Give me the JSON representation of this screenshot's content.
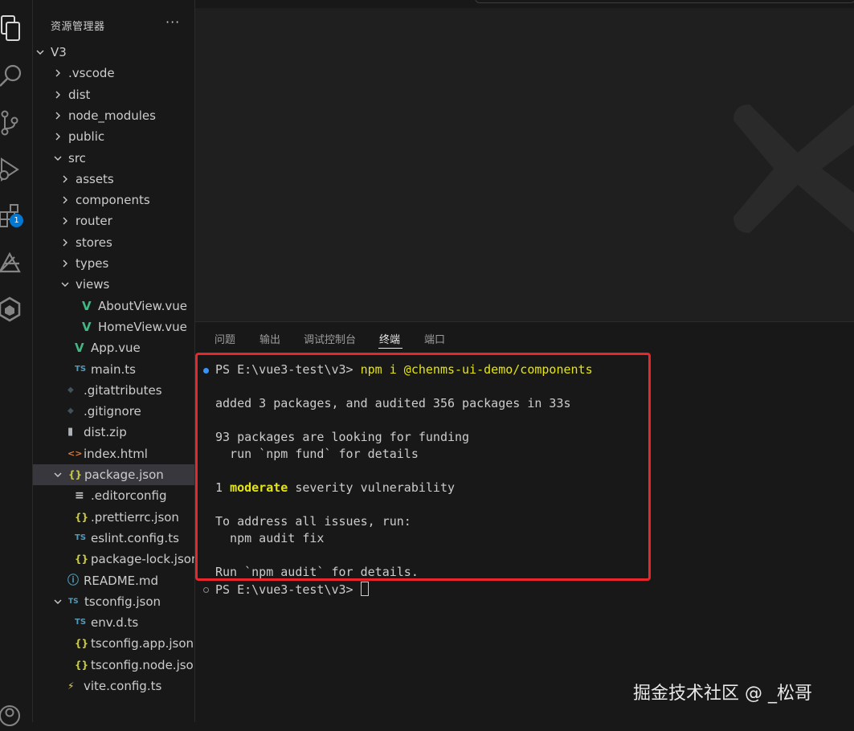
{
  "sidebar": {
    "title": "资源管理器",
    "more": "···",
    "tree": [
      {
        "name": "V3",
        "type": "folder-open",
        "depth": 0,
        "icon": ""
      },
      {
        "name": ".vscode",
        "type": "folder",
        "depth": 1,
        "icon": ""
      },
      {
        "name": "dist",
        "type": "folder",
        "depth": 1,
        "icon": ""
      },
      {
        "name": "node_modules",
        "type": "folder",
        "depth": 1,
        "icon": ""
      },
      {
        "name": "public",
        "type": "folder",
        "depth": 1,
        "icon": ""
      },
      {
        "name": "src",
        "type": "folder-open",
        "depth": 1,
        "icon": ""
      },
      {
        "name": "assets",
        "type": "folder",
        "depth": 2,
        "icon": ""
      },
      {
        "name": "components",
        "type": "folder",
        "depth": 2,
        "icon": ""
      },
      {
        "name": "router",
        "type": "folder",
        "depth": 2,
        "icon": ""
      },
      {
        "name": "stores",
        "type": "folder",
        "depth": 2,
        "icon": ""
      },
      {
        "name": "types",
        "type": "folder",
        "depth": 2,
        "icon": ""
      },
      {
        "name": "views",
        "type": "folder-open",
        "depth": 2,
        "icon": ""
      },
      {
        "name": "AboutView.vue",
        "type": "file",
        "depth": 3,
        "icon": "vue"
      },
      {
        "name": "HomeView.vue",
        "type": "file",
        "depth": 3,
        "icon": "vue"
      },
      {
        "name": "App.vue",
        "type": "file",
        "depth": 2,
        "icon": "vue"
      },
      {
        "name": "main.ts",
        "type": "file",
        "depth": 2,
        "icon": "ts"
      },
      {
        "name": ".gitattributes",
        "type": "file",
        "depth": 1,
        "icon": "git"
      },
      {
        "name": ".gitignore",
        "type": "file",
        "depth": 1,
        "icon": "git"
      },
      {
        "name": "dist.zip",
        "type": "file",
        "depth": 1,
        "icon": "zip"
      },
      {
        "name": "index.html",
        "type": "file",
        "depth": 1,
        "icon": "html"
      },
      {
        "name": "package.json",
        "type": "file-open",
        "depth": 1,
        "icon": "json",
        "selected": true
      },
      {
        "name": ".editorconfig",
        "type": "file",
        "depth": 2,
        "icon": "lines"
      },
      {
        "name": ".prettierrc.json",
        "type": "file",
        "depth": 2,
        "icon": "json"
      },
      {
        "name": "eslint.config.ts",
        "type": "file",
        "depth": 2,
        "icon": "ts"
      },
      {
        "name": "package-lock.json",
        "type": "file",
        "depth": 2,
        "icon": "json"
      },
      {
        "name": "README.md",
        "type": "file",
        "depth": 1,
        "icon": "info"
      },
      {
        "name": "tsconfig.json",
        "type": "file-open",
        "depth": 1,
        "icon": "tsbox"
      },
      {
        "name": "env.d.ts",
        "type": "file",
        "depth": 2,
        "icon": "ts"
      },
      {
        "name": "tsconfig.app.json",
        "type": "file",
        "depth": 2,
        "icon": "json"
      },
      {
        "name": "tsconfig.node.json",
        "type": "file",
        "depth": 2,
        "icon": "json"
      },
      {
        "name": "vite.config.ts",
        "type": "file",
        "depth": 1,
        "icon": "vite"
      }
    ]
  },
  "activity": {
    "icons": [
      "explorer-icon",
      "search-icon",
      "source-control-icon",
      "run-debug-icon",
      "extensions-icon",
      "remote-icon",
      "package-icon",
      "account-icon"
    ],
    "badge": "1"
  },
  "panel": {
    "tabs": [
      "问题",
      "输出",
      "调试控制台",
      "终端",
      "端口"
    ],
    "active_tab": "终端"
  },
  "terminal": {
    "prompt1": "PS E:\\vue3-test\\v3> ",
    "command": "npm i @chenms-ui-demo/components",
    "line_added": "added 3 packages, and audited 356 packages in 33s",
    "line_funding": "93 packages are looking for funding",
    "line_fund_details": "  run `npm fund` for details",
    "line_vuln_count": "1 ",
    "line_vuln_level": "moderate",
    "line_vuln_rest": " severity vulnerability",
    "line_address": "To address all issues, run:",
    "line_fix": "  npm audit fix",
    "line_details": "Run `npm audit` for details.",
    "prompt2": "PS E:\\vue3-test\\v3> "
  },
  "watermark": "掘金技术社区 @ _松哥",
  "colors": {
    "accent": "#0078d4",
    "highlight": "#e8262b",
    "vue": "#41b883",
    "ts": "#519aba",
    "json": "#cbcb41"
  }
}
